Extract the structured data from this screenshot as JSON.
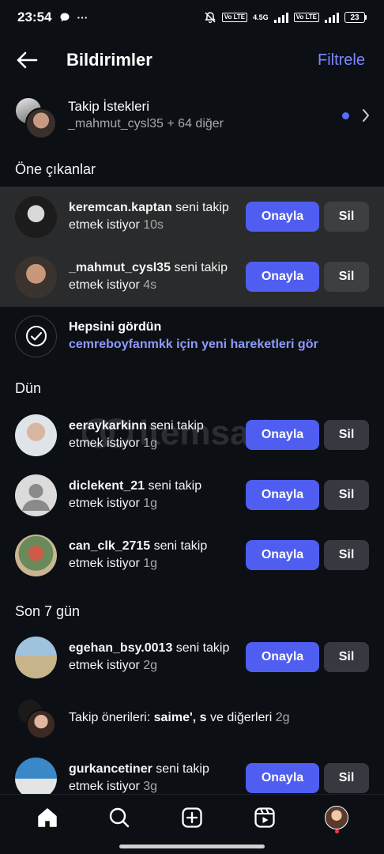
{
  "status_bar": {
    "time": "23:54",
    "more": "···",
    "net_label": "4.5G",
    "lte1": "Vo LTE",
    "lte2": "Vo LTE",
    "battery": "23"
  },
  "header": {
    "title": "Bildirimler",
    "filter_label": "Filtrele"
  },
  "follow_requests": {
    "title": "Takip İstekleri",
    "subtitle": "_mahmut_cysl35 + 64 diğer"
  },
  "sections": {
    "highlighted": "Öne çıkanlar",
    "yesterday": "Dün",
    "last7": "Son 7 gün"
  },
  "buttons": {
    "approve": "Onayla",
    "delete": "Sil"
  },
  "highlighted_requests": [
    {
      "username": "keremcan.kaptan",
      "text": " seni takip etmek istiyor ",
      "time": "10s"
    },
    {
      "username": "_mahmut_cysl35",
      "text": " seni takip etmek istiyor ",
      "time": "4s"
    }
  ],
  "seen_all": {
    "title": "Hepsini gördün",
    "link": "cemreboyfanmkk için yeni hareketleri gör"
  },
  "yesterday_requests": [
    {
      "username": "eeraykarkinn",
      "text": " seni takip etmek istiyor ",
      "time": "1g"
    },
    {
      "username": "diclekent_21",
      "text": " seni takip etmek istiyor ",
      "time": "1g"
    },
    {
      "username": "can_clk_2715",
      "text": " seni takip etmek istiyor ",
      "time": "1g"
    }
  ],
  "week_requests": [
    {
      "username": "egehan_bsy.0013",
      "text": " seni takip etmek istiyor ",
      "time": "2g"
    },
    {
      "username": "gurkancetiner",
      "text": " seni takip etmek istiyor ",
      "time": "3g"
    }
  ],
  "suggestions": {
    "prefix": "Takip önerileri: ",
    "names": "saime', s",
    "suffix": " ve diğerleri ",
    "time": "2g"
  },
  "watermark": "itemsatis",
  "nav": [
    "home-icon",
    "search-icon",
    "create-icon",
    "reels-icon",
    "profile-avatar"
  ],
  "colors": {
    "background": "#0c1014",
    "accent": "#4f5ef0",
    "link": "#8f9bff",
    "highlight": "#2a2b2c"
  }
}
